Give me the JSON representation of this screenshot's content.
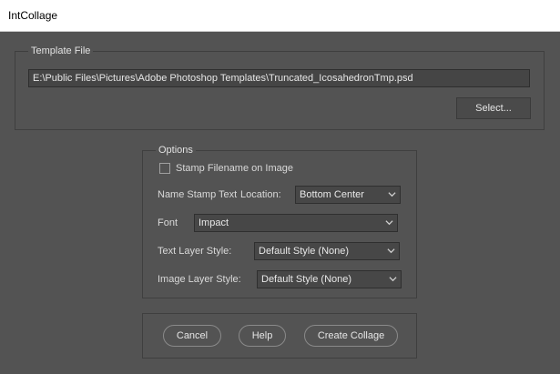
{
  "window": {
    "title": "IntCollage"
  },
  "template_file": {
    "group_label": "Template File",
    "path_value": "E:\\Public Files\\Pictures\\Adobe Photoshop Templates\\Truncated_IcosahedronTmp.psd",
    "select_label": "Select..."
  },
  "options": {
    "group_label": "Options",
    "stamp_filename": {
      "label": "Stamp Filename on Image",
      "checked": false
    },
    "name_stamp_label": "Name Stamp Text",
    "location_label": "Location:",
    "location_value": "Bottom Center",
    "font_label": "Font",
    "font_value": "Impact",
    "text_layer_style_label": "Text Layer Style:",
    "text_layer_style_value": "Default Style (None)",
    "image_layer_style_label": "Image Layer Style:",
    "image_layer_style_value": "Default Style (None)"
  },
  "buttons": {
    "cancel_label": "Cancel",
    "help_label": "Help",
    "create_label": "Create Collage"
  }
}
